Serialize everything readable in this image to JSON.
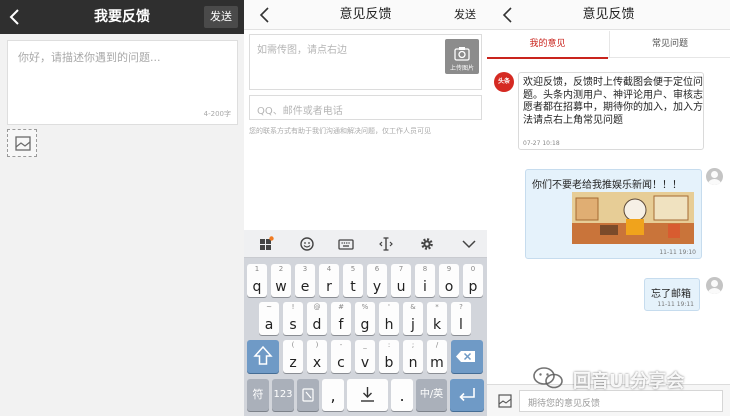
{
  "panel1": {
    "title": "我要反馈",
    "send_label": "发送",
    "textarea_placeholder": "你好，请描述你遇到的问题...",
    "char_limit": "4-200字"
  },
  "panel2": {
    "title": "意见反馈",
    "send_label": "发送",
    "upload_placeholder": "如需传图，请点右边",
    "upload_button_label": "上传图片",
    "contact_placeholder": "QQ、邮件或者电话",
    "contact_note": "您的联系方式有助于我们沟通和解决问题，仅工作人员可见",
    "keyboard": {
      "row1": [
        {
          "main": "q",
          "sub": "1"
        },
        {
          "main": "w",
          "sub": "2"
        },
        {
          "main": "e",
          "sub": "3"
        },
        {
          "main": "r",
          "sub": "4"
        },
        {
          "main": "t",
          "sub": "5"
        },
        {
          "main": "y",
          "sub": "6"
        },
        {
          "main": "u",
          "sub": "7"
        },
        {
          "main": "i",
          "sub": "8"
        },
        {
          "main": "o",
          "sub": "9"
        },
        {
          "main": "p",
          "sub": "0"
        }
      ],
      "row2": [
        {
          "main": "a",
          "sub": "~"
        },
        {
          "main": "s",
          "sub": "!"
        },
        {
          "main": "d",
          "sub": "@"
        },
        {
          "main": "f",
          "sub": "#"
        },
        {
          "main": "g",
          "sub": "%"
        },
        {
          "main": "h",
          "sub": "'"
        },
        {
          "main": "j",
          "sub": "&"
        },
        {
          "main": "k",
          "sub": "*"
        },
        {
          "main": "l",
          "sub": "?"
        }
      ],
      "row3": [
        {
          "main": "z",
          "sub": "("
        },
        {
          "main": "x",
          "sub": ")"
        },
        {
          "main": "c",
          "sub": "-"
        },
        {
          "main": "v",
          "sub": "_"
        },
        {
          "main": "b",
          "sub": ":"
        },
        {
          "main": "n",
          "sub": ";"
        },
        {
          "main": "m",
          "sub": "/"
        }
      ],
      "symbol_key": "符",
      "number_key": "123",
      "comma_key": ",",
      "period_key": ".",
      "lang_key": "中/英"
    }
  },
  "panel3": {
    "title": "意见反馈",
    "tab_mine": "我的意见",
    "tab_faq": "常见问题",
    "sys_avatar_text": "头条",
    "sys_message": "欢迎反馈，反馈时上传截图会便于定位问题。头条内测用户、神评论用户、审核志愿者都在招募中，期待你的加入，加入方法请点右上角常见问题",
    "sys_time": "07-27 10:18",
    "msg1_text": "你们不要老给我推娱乐新闻！！！",
    "msg1_time": "11-11 19:10",
    "msg2_text": "忘了邮箱",
    "msg2_time": "11-11 19:11",
    "input_placeholder": "期待您的意见反馈"
  },
  "watermark_text": "回音UI分享会"
}
